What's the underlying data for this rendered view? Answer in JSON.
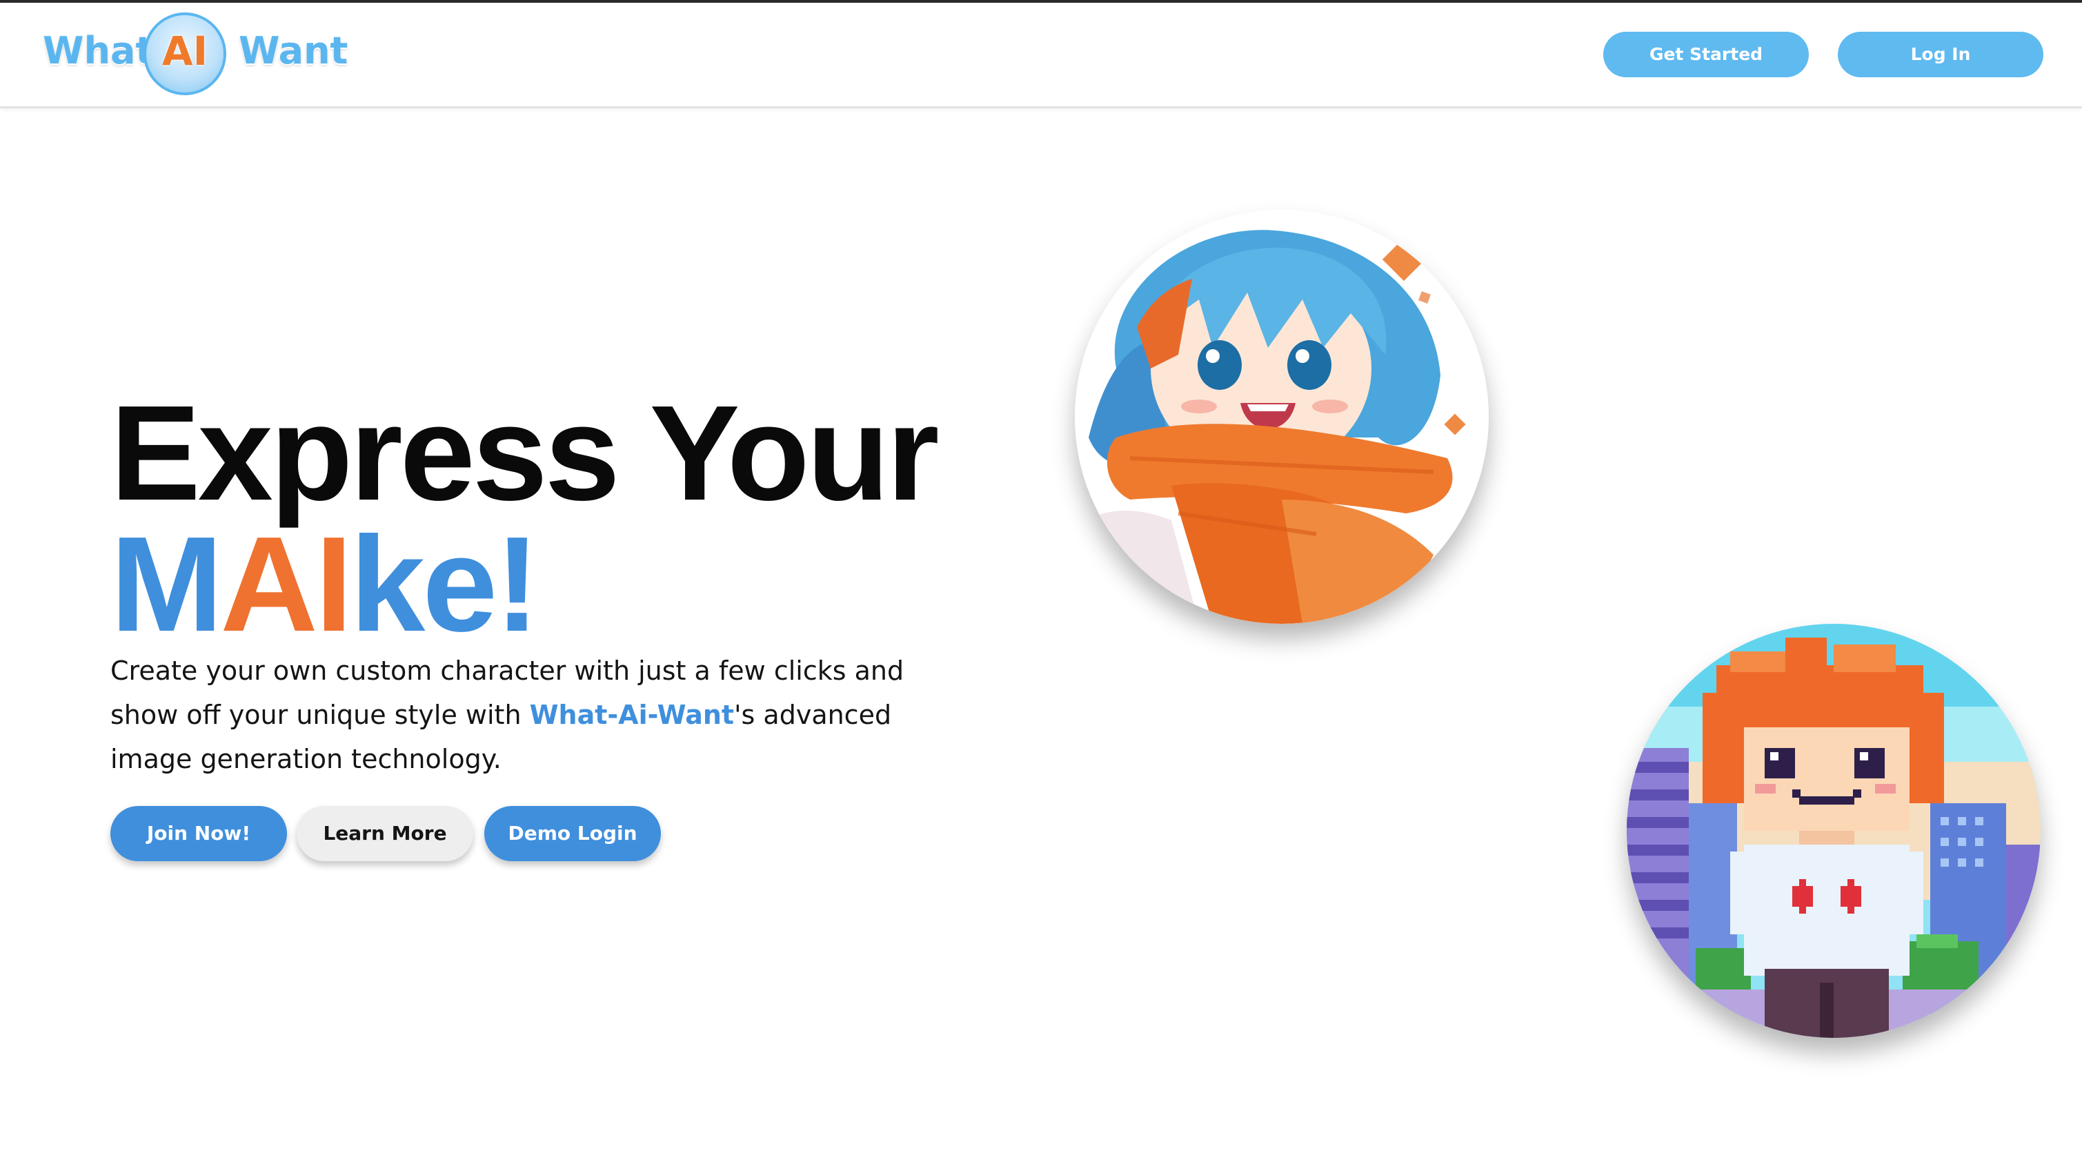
{
  "header": {
    "logo": {
      "left_word": "What",
      "badge_text": "AI",
      "right_word": "Want"
    },
    "nav": {
      "get_started_label": "Get Started",
      "login_label": "Log In"
    }
  },
  "hero": {
    "title_line1": "Express Your",
    "brand": {
      "m": "M",
      "ai": "AI",
      "ke": "ke!"
    },
    "description": {
      "before": "Create your own custom character with just a few clicks and show off your unique style with ",
      "brand_link": "What-Ai-Want",
      "after": "'s advanced image generation technology."
    },
    "buttons": {
      "join_label": "Join Now!",
      "learn_label": "Learn More",
      "demo_label": "Demo Login"
    }
  },
  "images": {
    "anime_character": {
      "icon": "anime-girl-blue-hair-orange-scarf"
    },
    "pixel_character": {
      "icon": "pixel-art-boy-orange-hair-city"
    }
  },
  "colors": {
    "primary_blue": "#3f8fdd",
    "nav_blue": "#5fbaf0",
    "accent_orange": "#ef7230",
    "logo_blue": "#5bb6ef"
  }
}
